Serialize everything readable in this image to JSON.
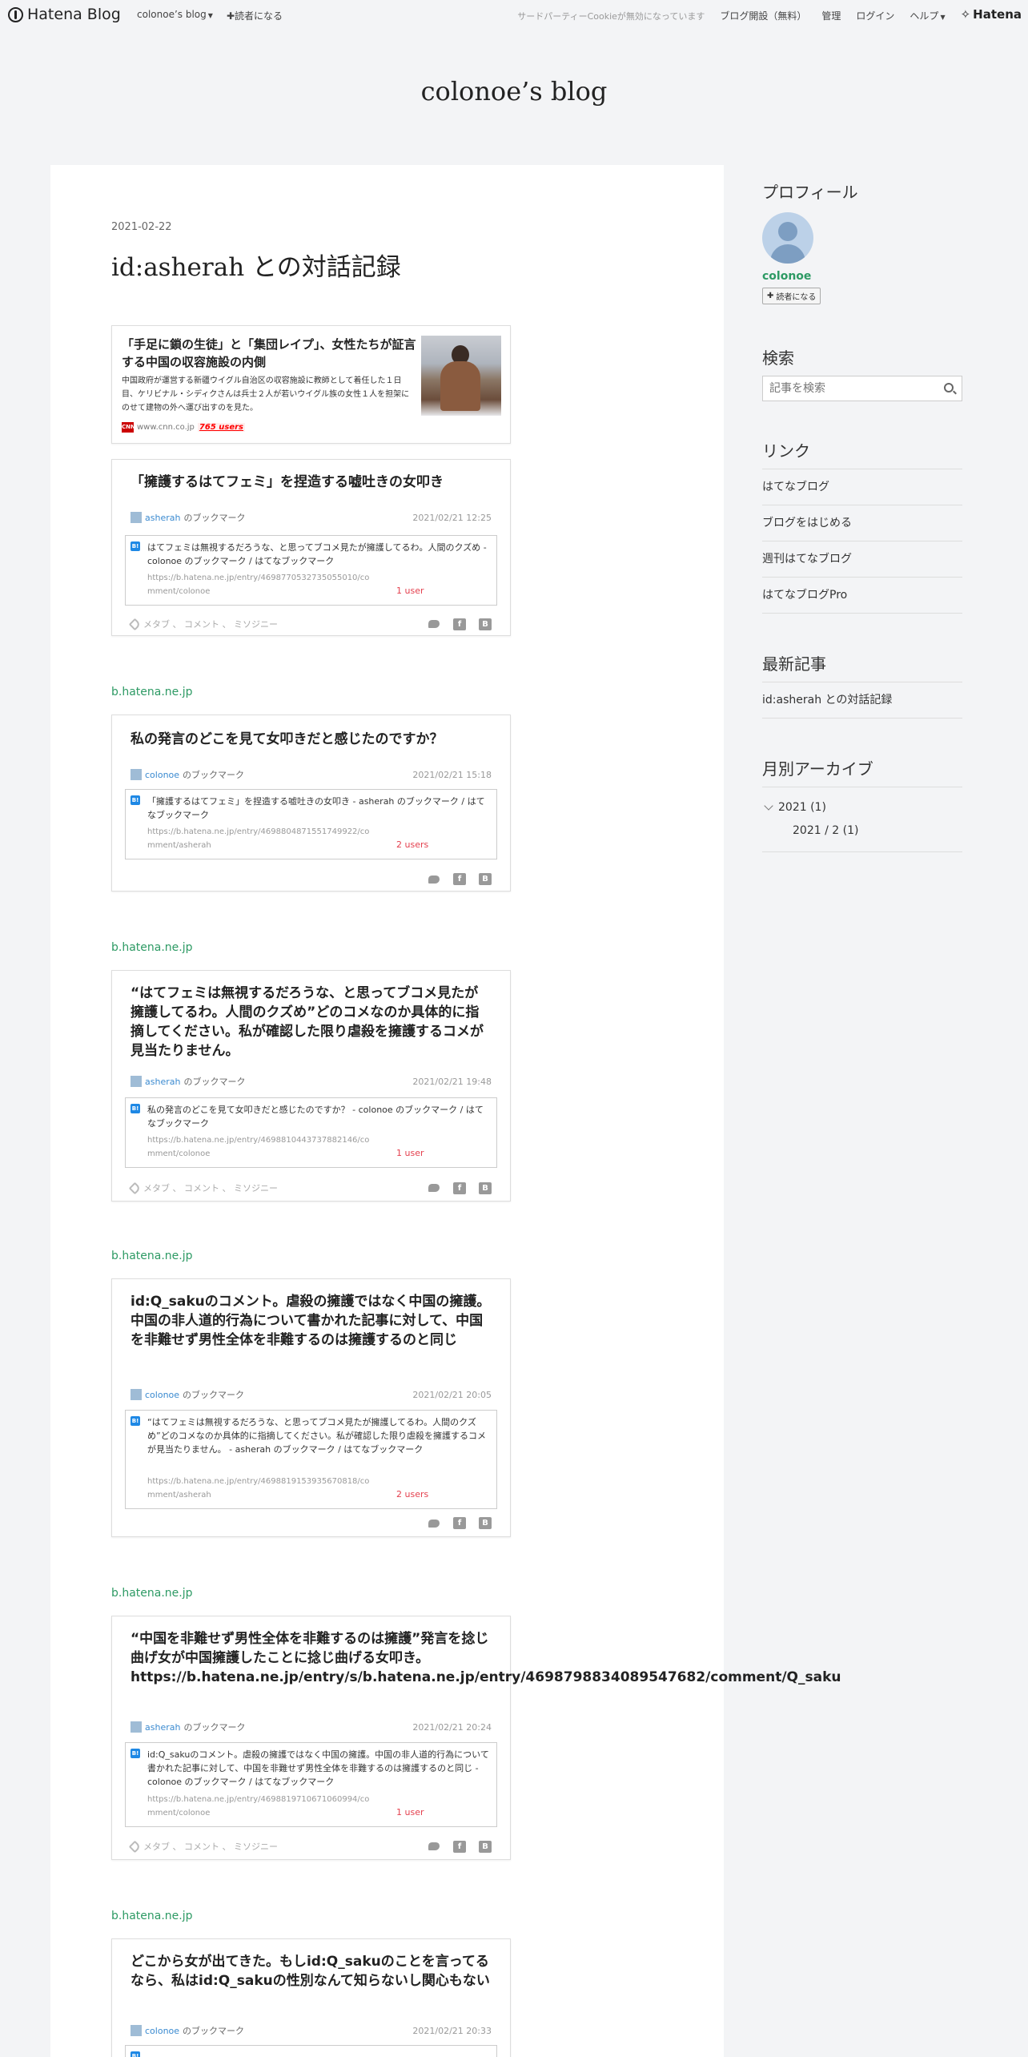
{
  "header": {
    "logo": "Hatena Blog",
    "blog_menu": "colonoe’s blog",
    "reader": "✚読者になる",
    "cookie_notice": "サードパーティーCookieが無効になっています",
    "open_blog": "ブログ開設（無料）",
    "admin": "管理",
    "login": "ログイン",
    "help": "ヘルプ",
    "brand": "Hatena"
  },
  "blog_title": "colonoe’s blog",
  "entry": {
    "date": "2021-02-22",
    "title": "id:asherah との対話記録"
  },
  "news_card": {
    "title": "「手足に鎖の生徒」と「集団レイプ」、女性たちが証言する中国の収容施設の内側",
    "description": "中国政府が運営する新疆ウイグル自治区の収容施設に教師として着任した１日目、ケリビナル・シディクさんは兵士２人が若いウイグル族の女性１人を担架にのせて建物の外へ運び出すのを見た。",
    "source": "www.cnn.co.jp",
    "source_icon": "CNN",
    "users": "765 users"
  },
  "cards": [
    {
      "title": "「擁護するはてフェミ」を捏造する嘘吐きの女叩き",
      "user": "asherah",
      "bookmark_suffix": "のブックマーク",
      "date": "2021/02/21 12:25",
      "quote": "はてフェミは無視するだろうな、と思ってブコメ見たが擁護してるわ。人間のクズめ - colonoe のブックマーク / はてなブックマーク",
      "url1": "https://b.hatena.ne.jp/entry/4698770532735055010/co",
      "url2": "mment/colonoe",
      "count": "1 user",
      "tags": "メタブ 、 コメント 、 ミソジニー"
    },
    {
      "source": "b.hatena.ne.jp",
      "title": "私の発言のどこを見て女叩きだと感じたのですか？",
      "user": "colonoe",
      "bookmark_suffix": "のブックマーク",
      "date": "2021/02/21 15:18",
      "quote": "「擁護するはてフェミ」を捏造する嘘吐きの女叩き - asherah のブックマーク / はてなブックマーク",
      "url1": "https://b.hatena.ne.jp/entry/4698804871551749922/co",
      "url2": "mment/asherah",
      "count": "2 users"
    },
    {
      "source": "b.hatena.ne.jp",
      "title": "“はてフェミは無視するだろうな、と思ってブコメ見たが擁護してるわ。人間のクズめ”どのコメなのか具体的に指摘してください。私が確認した限り虐殺を擁護するコメが見当たりません。",
      "user": "asherah",
      "bookmark_suffix": "のブックマーク",
      "date": "2021/02/21 19:48",
      "quote": "私の発言のどこを見て女叩きだと感じたのですか？ - colonoe のブックマーク / はてなブックマーク",
      "url1": "https://b.hatena.ne.jp/entry/4698810443737882146/co",
      "url2": "mment/colonoe",
      "count": "1 user",
      "tags": "メタブ 、 コメント 、 ミソジニー"
    },
    {
      "source": "b.hatena.ne.jp",
      "title": "id:Q_sakuのコメント。虐殺の擁護ではなく中国の擁護。中国の非人道的行為について書かれた記事に対して、中国を非難せず男性全体を非難するのは擁護するのと同じ",
      "user": "colonoe",
      "bookmark_suffix": "のブックマーク",
      "date": "2021/02/21 20:05",
      "quote": "“はてフェミは無視するだろうな、と思ってブコメ見たが擁護してるわ。人間のクズめ”どのコメなのか具体的に指摘してください。私が確認した限り虐殺を擁護するコメが見当たりません。 - asherah のブックマーク / はてなブックマーク",
      "url1": "https://b.hatena.ne.jp/entry/4698819153935670818/co",
      "url2": "mment/asherah",
      "count": "2 users"
    },
    {
      "source": "b.hatena.ne.jp",
      "title": "“中国を非難せず男性全体を非難するのは擁護”発言を捻じ曲げ女が中国擁護したことに捻じ曲げる女叩き。https://b.hatena.ne.jp/entry/s/b.hatena.ne.jp/entry/4698798834089547682/comment/Q_saku",
      "user": "asherah",
      "bookmark_suffix": "のブックマーク",
      "date": "2021/02/21 20:24",
      "quote": "id:Q_sakuのコメント。虐殺の擁護ではなく中国の擁護。中国の非人道的行為について書かれた記事に対して、中国を非難せず男性全体を非難するのは擁護するのと同じ - colonoe のブックマーク / はてなブックマーク",
      "url1": "https://b.hatena.ne.jp/entry/4698819710671060994/co",
      "url2": "mment/colonoe",
      "count": "1 user",
      "tags": "メタブ 、 コメント 、 ミソジニー"
    },
    {
      "source": "b.hatena.ne.jp",
      "title": "どこから女が出てきた。もしid:Q_sakuのことを言ってるなら、私はid:Q_sakuの性別なんて知らないし関心もない",
      "user": "colonoe",
      "bookmark_suffix": "のブックマーク",
      "date": "2021/02/21 20:33"
    }
  ],
  "sidebar": {
    "profile_heading": "プロフィール",
    "profile_name": "colonoe",
    "reader_button": "読者になる",
    "search_heading": "検索",
    "search_placeholder": "記事を検索",
    "links_heading": "リンク",
    "links": [
      "はてなブログ",
      "ブログをはじめる",
      "週刊はてなブログ",
      "はてなブログPro"
    ],
    "recent_heading": "最新記事",
    "recent": [
      "id:asherah との対話記録"
    ],
    "archive_heading": "月別アーカイブ",
    "archive_year": "2021 (1)",
    "archive_month": "2021 / 2 (1)"
  }
}
